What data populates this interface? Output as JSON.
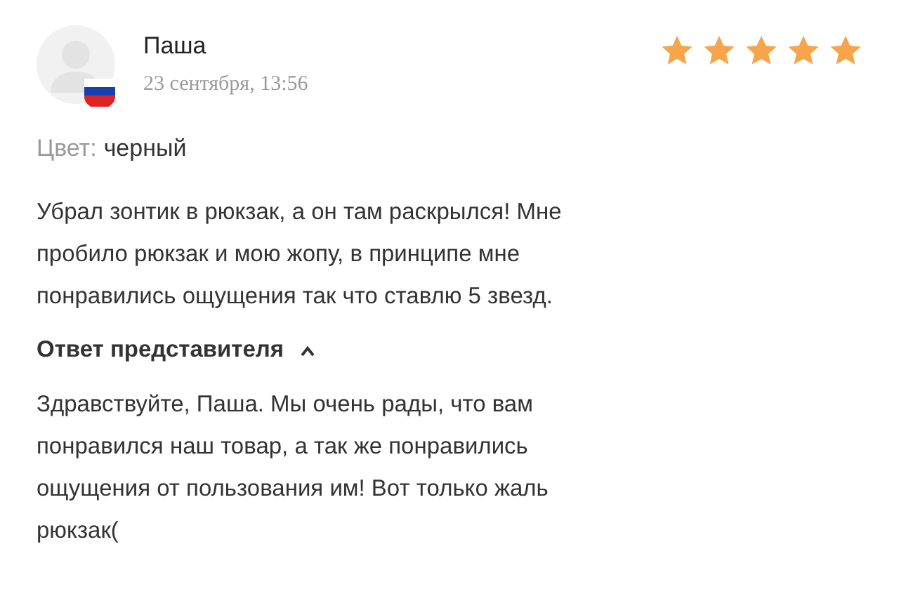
{
  "review": {
    "author": "Паша",
    "date": "23 сентября, 13:56",
    "stars": 5,
    "attribute": {
      "label": "Цвет:",
      "value": "черный"
    },
    "text": "Убрал зонтик в рюкзак, а он там раскрылся! Мне\nпробило рюкзак и мою жопу, в принципе мне\nпонравились ощущения так что ставлю 5 звезд."
  },
  "reply": {
    "title": "Ответ представителя",
    "expanded": true,
    "text": "Здравствуйте, Паша. Мы очень рады, что вам\nпонравился наш товар, а так же понравились\nощущения от пользования им! Вот только жаль\nрюкзак("
  }
}
